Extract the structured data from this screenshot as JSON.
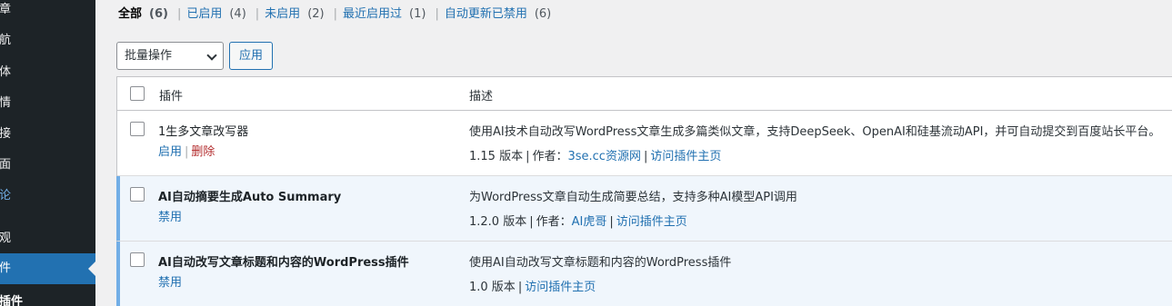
{
  "sidebar": {
    "items": [
      {
        "label": "章"
      },
      {
        "label": "航"
      },
      {
        "label": "体"
      },
      {
        "label": "情"
      },
      {
        "label": "接"
      },
      {
        "label": "面"
      },
      {
        "label": "论"
      },
      {
        "label": "观"
      },
      {
        "label": "件"
      },
      {
        "label": "插件"
      }
    ]
  },
  "filters": {
    "all": {
      "label": "全部",
      "count": "(6)"
    },
    "active": {
      "label": "已启用",
      "count": "(4)"
    },
    "inactive": {
      "label": "未启用",
      "count": "(2)"
    },
    "recent": {
      "label": "最近启用过",
      "count": "(1)"
    },
    "autoupdate": {
      "label": "自动更新已禁用",
      "count": "(6)"
    },
    "separator": "|"
  },
  "bulk": {
    "selected": "批量操作",
    "apply_label": "应用"
  },
  "table": {
    "headers": {
      "plugin": "插件",
      "description": "描述"
    },
    "rows": [
      {
        "title": "1生多文章改写器",
        "actions": [
          "启用",
          "删除"
        ],
        "description": "使用AI技术自动改写WordPress文章生成多篇类似文章，支持DeepSeek、OpenAI和硅基流动API，并可自动提交到百度站长平台。",
        "version": "1.15 版本",
        "author_prefix": "作者：",
        "author": "3se.cc资源网",
        "visit": "访问插件主页"
      },
      {
        "title": "AI自动摘要生成Auto Summary",
        "actions": [
          "禁用"
        ],
        "description": "为WordPress文章自动生成简要总结，支持多种AI模型API调用",
        "version": "1.2.0 版本",
        "author_prefix": "作者：",
        "author": "AI虎哥",
        "visit": "访问插件主页"
      },
      {
        "title": "AI自动改写文章标题和内容的WordPress插件",
        "actions": [
          "禁用"
        ],
        "description": "使用AI自动改写文章标题和内容的WordPress插件",
        "version": "1.0 版本",
        "visit": "访问插件主页"
      }
    ]
  },
  "colors": {
    "accent": "#2271b1",
    "sidebar": "#1d2327",
    "active_row": "#f0f6fc",
    "delete": "#b32d2e"
  }
}
